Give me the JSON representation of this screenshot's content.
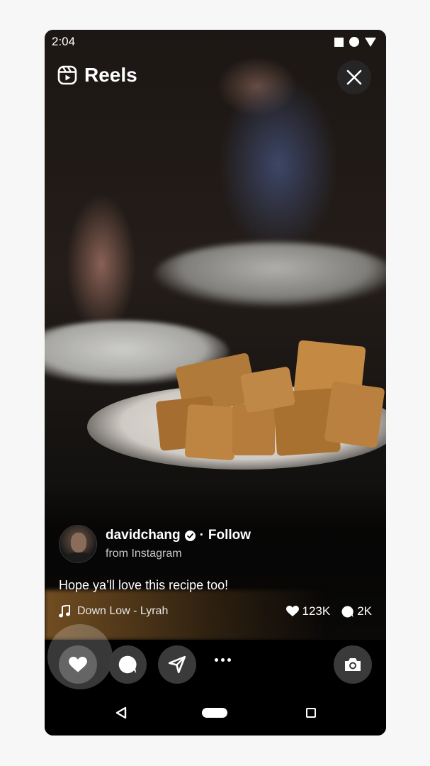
{
  "status_bar": {
    "time": "2:04",
    "icons": [
      "square-status-icon",
      "circle-status-icon",
      "triangle-status-icon"
    ]
  },
  "header": {
    "title": "Reels",
    "icon": "reels-icon",
    "close_icon": "close-icon"
  },
  "post": {
    "username": "davidchang",
    "verified": true,
    "separator": "·",
    "follow_label": "Follow",
    "source": "from Instagram",
    "caption": "Hope ya’ll love this recipe too!",
    "audio": "Down Low - Lyrah",
    "likes": "123K",
    "comments": "2K"
  },
  "actions": {
    "items": [
      "like-icon",
      "comment-icon",
      "share-icon",
      "more-icon",
      "camera-icon"
    ]
  },
  "nav": {
    "items": [
      "back-icon",
      "home-icon",
      "recents-icon"
    ]
  },
  "colors": {
    "background": "#000000",
    "action_button": "#3a3a3a",
    "text": "#ffffff",
    "muted_text": "#c9c9c9"
  }
}
